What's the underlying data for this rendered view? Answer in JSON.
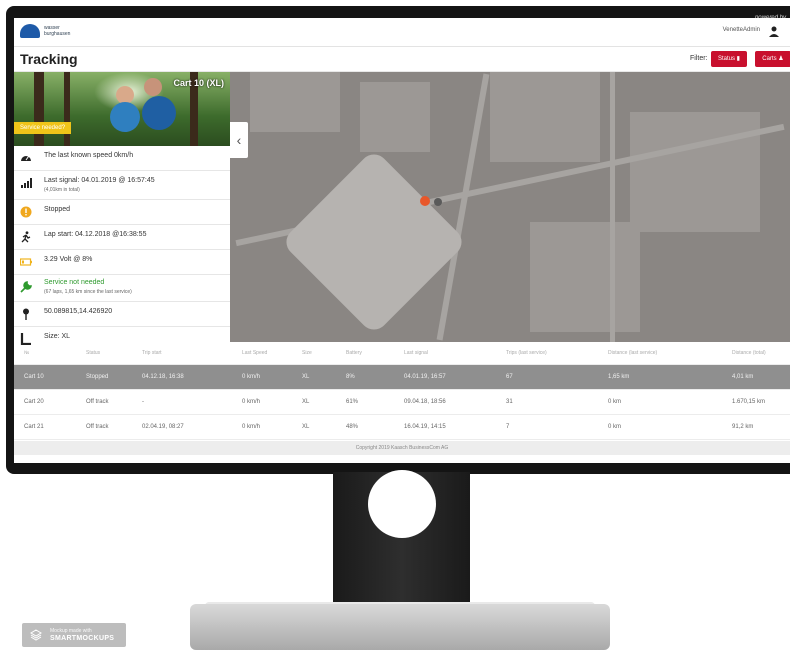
{
  "powered_by": "powered by",
  "app": {
    "logo_text": "wasser burghausen",
    "user": "VenetteAdmin",
    "page_title": "Tracking",
    "filter_label": "Filter:",
    "buttons": {
      "status": "Status ▮",
      "carts": "Carts ♟"
    }
  },
  "cart": {
    "title": "Cart 10 (XL)",
    "service_tag": "Service needed?",
    "details": [
      {
        "icon": "speedometer-icon",
        "text": "The last known speed 0km/h",
        "sub": ""
      },
      {
        "icon": "signal-icon",
        "text": "Last signal: 04.01.2019 @ 16:57:45",
        "sub": "(4,01km in total)"
      },
      {
        "icon": "warning-icon",
        "text": "Stopped",
        "sub": ""
      },
      {
        "icon": "runner-icon",
        "text": "Lap start: 04.12.2018 @16:38:55",
        "sub": ""
      },
      {
        "icon": "battery-icon",
        "text": "3.29 Volt @ 8%",
        "sub": ""
      },
      {
        "icon": "wrench-icon",
        "text": "Service not needed",
        "sub": "(67 laps, 1,65 km since the last service)"
      },
      {
        "icon": "pin-icon",
        "text": "50.089815,14.426920",
        "sub": ""
      },
      {
        "icon": "size-icon",
        "text": "Size: XL",
        "sub": ""
      }
    ]
  },
  "table": {
    "headers": [
      "№",
      "Status",
      "Trip start",
      "Last Speed",
      "Size",
      "Battery",
      "Last signal",
      "Trips (last service)",
      "Distance (last service)",
      "Distance (total)"
    ],
    "rows": [
      [
        "Cart 10",
        "Stopped",
        "04.12.18, 16:38",
        "0 km/h",
        "XL",
        "8%",
        "04.01.19, 16:57",
        "67",
        "1,65 km",
        "4,01 km"
      ],
      [
        "Cart 20",
        "Off track",
        "-",
        "0 km/h",
        "XL",
        "61%",
        "09.04.18, 18:56",
        "31",
        "0 km",
        "1.670,15 km"
      ],
      [
        "Cart 21",
        "Off track",
        "02.04.19, 08:27",
        "0 km/h",
        "XL",
        "48%",
        "16.04.19, 14:15",
        "7",
        "0 km",
        "91,2 km"
      ]
    ]
  },
  "footer": "Copyright 2019 Kaasch BusinessCom AG",
  "badge": {
    "line1": "Mockup made with",
    "line2": "SMARTMOCKUPS"
  },
  "colors": {
    "accent": "#c8102e",
    "service_warning": "#f0c419",
    "ok_green": "#2e9a2e"
  }
}
